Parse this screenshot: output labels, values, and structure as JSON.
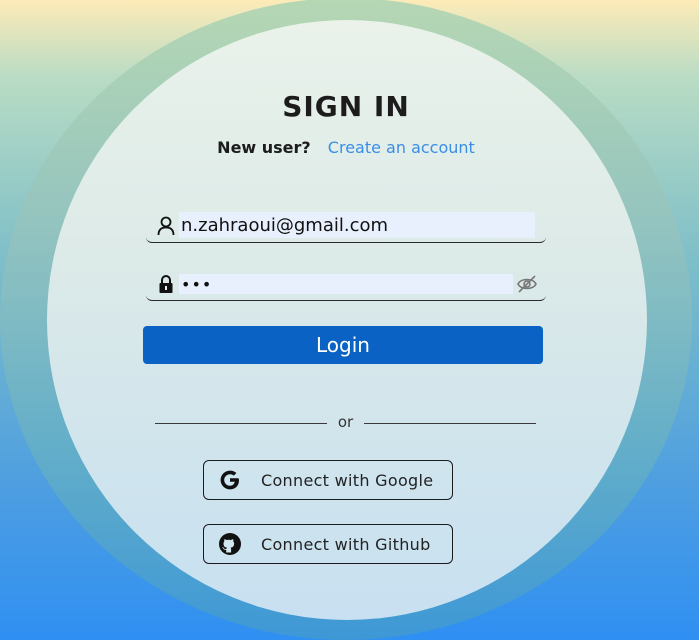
{
  "header": {
    "title": "SIGN IN"
  },
  "signup_prompt": {
    "label": "New user?",
    "link": "Create an account"
  },
  "form": {
    "email_value": "n.zahraoui@gmail.com",
    "password_value": "•••",
    "login_label": "Login"
  },
  "divider": {
    "text": "or"
  },
  "oauth": {
    "google_label": "Connect with Google",
    "github_label": "Connect with Github"
  },
  "colors": {
    "primary_button": "#0a63c4",
    "link": "#3a8ee6",
    "input_background": "#e8f0fe"
  },
  "icons": {
    "email_field": "user-icon",
    "password_field": "lock-icon",
    "password_toggle": "eye-off-icon",
    "google": "google-icon",
    "github": "github-icon"
  }
}
